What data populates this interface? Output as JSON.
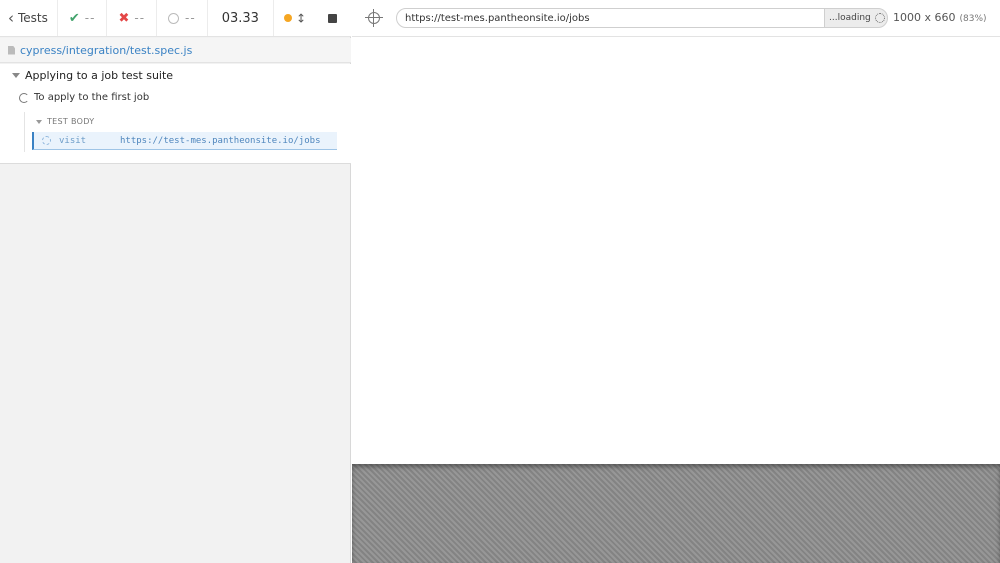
{
  "reporter": {
    "back_label": "Tests",
    "passed": "--",
    "failed": "--",
    "pending": "--",
    "duration": "03.33",
    "spec_path": "cypress/integration/test.spec.js",
    "suite_title": "Applying to a job test suite",
    "test_title": "To apply to the first job",
    "hook_label": "TEST BODY",
    "command": {
      "name": "visit",
      "message": "https://test-mes.pantheonsite.io/jobs"
    }
  },
  "runner": {
    "url": "https://test-mes.pantheonsite.io/jobs",
    "loading_label": "...loading",
    "viewport_size": "1000 x 660",
    "viewport_scale": "(83%)"
  },
  "colors": {
    "pass": "#41a36b",
    "fail": "#e44646",
    "accent": "#3a82c4",
    "running": "#f5a623"
  },
  "icons": {
    "back": "chevron-left-icon",
    "pass": "check-icon",
    "fail": "x-icon",
    "pending": "circle-icon",
    "auto_scroll": "orange-dot-icon",
    "arrows": "up-down-arrows-icon",
    "stop": "stop-icon",
    "file": "file-icon",
    "selector": "crosshair-icon"
  }
}
